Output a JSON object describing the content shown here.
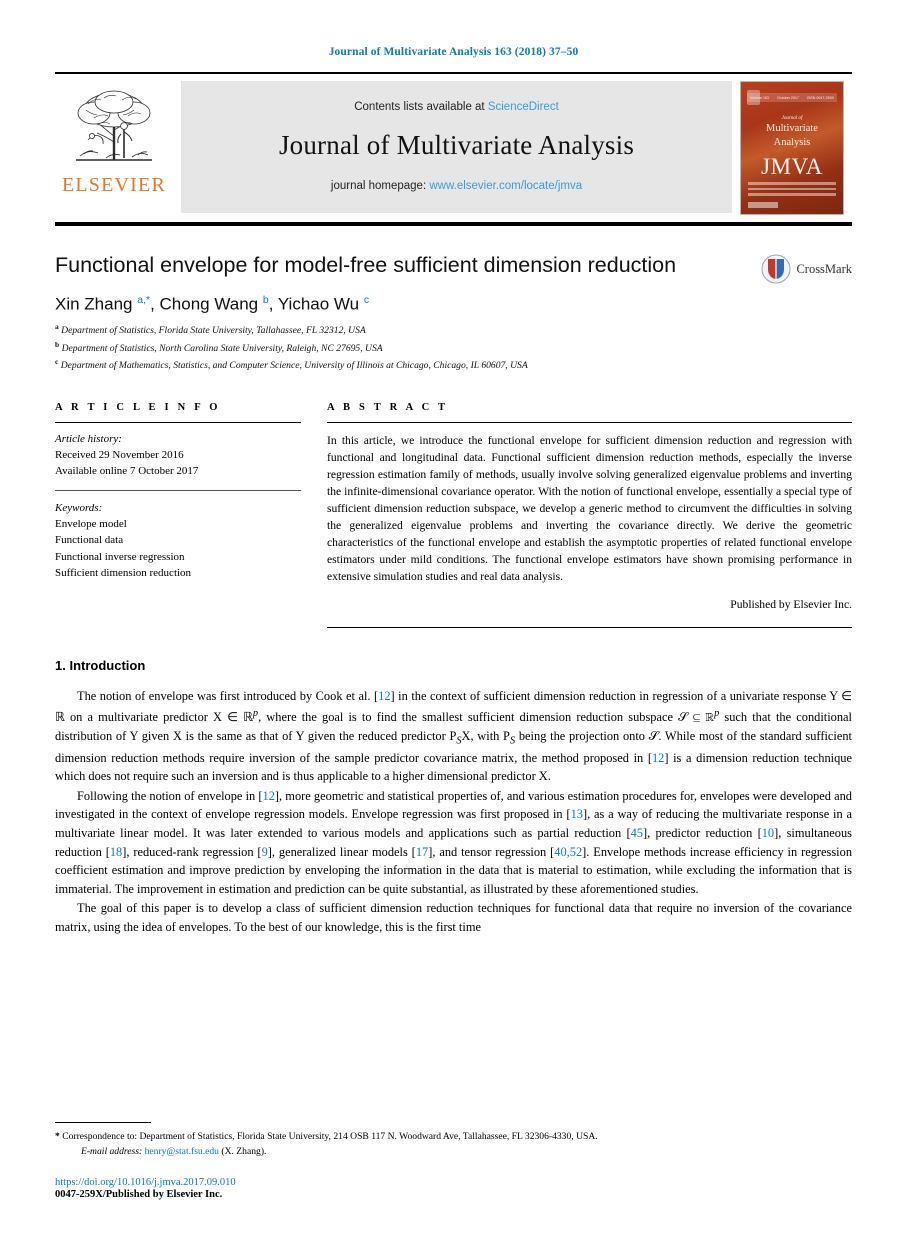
{
  "running_head": "Journal of Multivariate Analysis 163 (2018) 37–50",
  "masthead": {
    "publisher_name": "ELSEVIER",
    "contents_prefix": "Contents lists available at",
    "contents_link": "ScienceDirect",
    "journal_title": "Journal of Multivariate Analysis",
    "homepage_prefix": "journal homepage:",
    "homepage_link": "www.elsevier.com/locate/jmva",
    "cover": {
      "volume_label": "Volume 163",
      "date_label": "October 2017",
      "issn_label": "ISSN 0047-259X",
      "line1": "Journal of",
      "line2": "Multivariate",
      "line3": "Analysis",
      "acronym": "JMVA",
      "publisher_mark": "ELSEVIER"
    }
  },
  "article": {
    "title": "Functional envelope for model-free sufficient dimension reduction",
    "crossmark_label": "CrossMark",
    "authors_html": "Xin Zhang <sup>a,*</sup>, Chong Wang <sup>b</sup>, Yichao Wu <sup>c</sup>",
    "affiliations": [
      {
        "marker": "a",
        "text": "Department of Statistics, Florida State University, Tallahassee, FL 32312, USA"
      },
      {
        "marker": "b",
        "text": "Department of Statistics, North Carolina State University, Raleigh, NC 27695, USA"
      },
      {
        "marker": "c",
        "text": "Department of Mathematics, Statistics, and Computer Science, University of Illinois at Chicago, Chicago, IL 60607, USA"
      }
    ]
  },
  "article_info": {
    "heading": "A R T I C L E   I N F O",
    "history_label": "Article history:",
    "received": "Received 29 November 2016",
    "available_online": "Available online 7 October 2017",
    "keywords_label": "Keywords:",
    "keywords": [
      "Envelope model",
      "Functional data",
      "Functional inverse regression",
      "Sufficient dimension reduction"
    ]
  },
  "abstract": {
    "heading": "A B S T R A C T",
    "text": "In this article, we introduce the functional envelope for sufficient dimension reduction and regression with functional and longitudinal data. Functional sufficient dimension reduction methods, especially the inverse regression estimation family of methods, usually involve solving generalized eigenvalue problems and inverting the infinite-dimensional covariance operator. With the notion of functional envelope, essentially a special type of sufficient dimension reduction subspace, we develop a generic method to circumvent the difficulties in solving the generalized eigenvalue problems and inverting the covariance directly. We derive the geometric characteristics of the functional envelope and establish the asymptotic properties of related functional envelope estimators under mild conditions. The functional envelope estimators have shown promising performance in extensive simulation studies and real data analysis.",
    "published_by": "Published by Elsevier Inc."
  },
  "section": {
    "number_title": "1.  Introduction",
    "paragraph_1_parts": [
      "The notion of envelope was first introduced by Cook et al. [",
      "12",
      "] in the context of  sufficient dimension reduction in regression of a univariate response Y ∈ ℝ on a multivariate predictor X ∈ ℝ",
      "p",
      ", where the goal is to find the smallest sufficient dimension reduction subspace 𝒮 ⊆ ℝ",
      "p",
      " such that the conditional distribution of Y given X is the same as that of Y given the reduced predictor P",
      "S",
      "X, with P",
      "S",
      " being the projection onto 𝒮. While most of the standard sufficient dimension reduction methods require inversion of the sample predictor covariance matrix, the method proposed in [",
      "12",
      "] is a dimension reduction technique which does not require such an inversion and is thus applicable to a higher dimensional predictor X."
    ],
    "paragraph_2_parts": [
      "Following the notion of envelope in [",
      "12",
      "], more geometric and statistical properties of, and various estimation procedures for, envelopes were developed and investigated in the context of envelope regression models. Envelope regression was first proposed in [",
      "13",
      "], as a way of reducing the multivariate response in a multivariate linear model. It was later extended to various models and applications such as partial reduction [",
      "45",
      "], predictor reduction [",
      "10",
      "], simultaneous reduction [",
      "18",
      "], reduced-rank regression [",
      "9",
      "], generalized linear models [",
      "17",
      "], and tensor regression [",
      "40,52",
      "]. Envelope methods increase efficiency in regression coefficient estimation and improve prediction by enveloping the information in the data that is material to estimation, while excluding the information that is immaterial. The improvement in estimation and prediction can be quite substantial, as illustrated by these aforementioned studies."
    ],
    "paragraph_3": "The goal of this paper is to develop a class of sufficient dimension reduction techniques for functional data that require no inversion of the covariance matrix, using the idea of envelopes. To the best of our knowledge, this is the first time"
  },
  "footer": {
    "correspondence_star": "*",
    "correspondence_text": "Correspondence to: Department of Statistics, Florida State University, 214 OSB 117 N. Woodward Ave, Tallahassee, FL 32306-4330, USA.",
    "email_label": "E-mail address:",
    "email": "henry@stat.fsu.edu",
    "email_suffix": "(X. Zhang).",
    "doi": "https://doi.org/10.1016/j.jmva.2017.09.010",
    "issn_line": "0047-259X/Published by Elsevier Inc."
  },
  "colors": {
    "link": "#0b7ab5",
    "link_light": "#3a9bd9",
    "elsevier_orange": "#E87722",
    "masthead_bg": "#e6e6e6",
    "cover_rust": "#b9401c"
  }
}
